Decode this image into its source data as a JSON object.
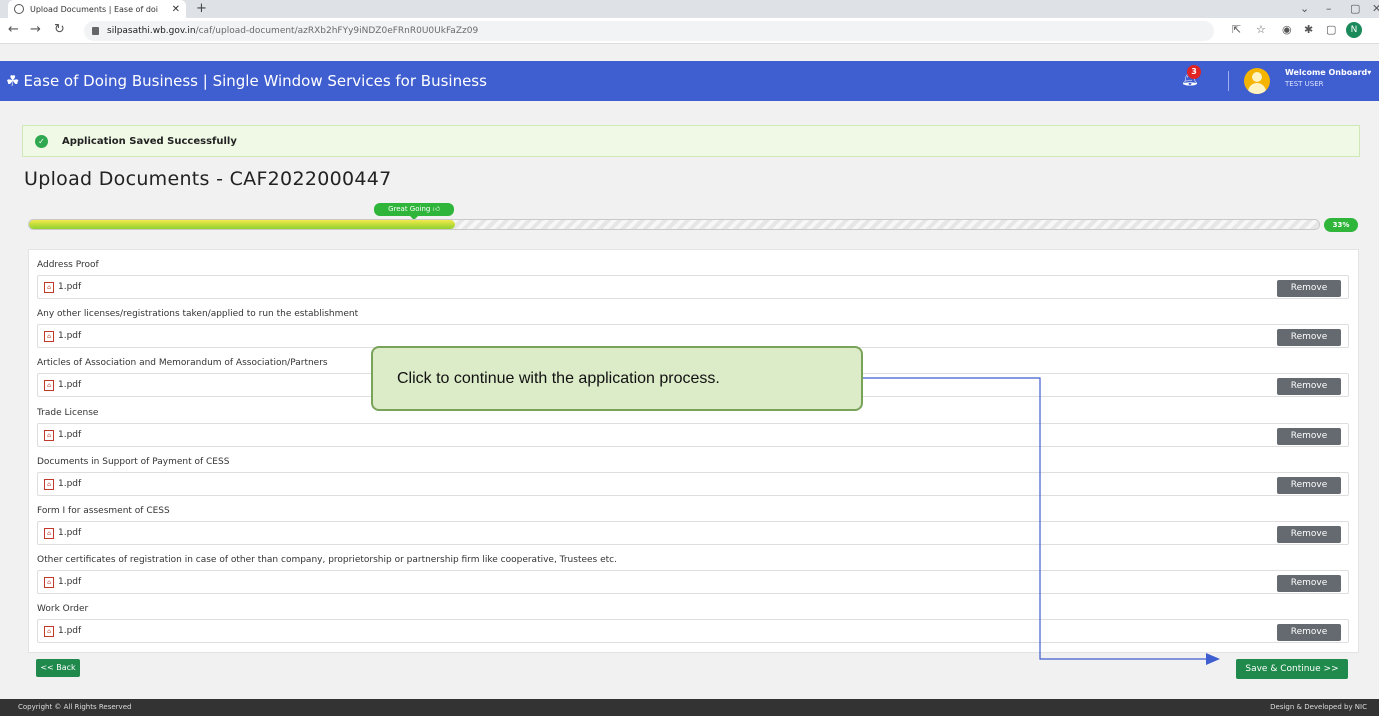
{
  "browser": {
    "tab_title": "Upload Documents | Ease of doi",
    "url_host": "silpasathi.wb.gov.in",
    "url_path": "/caf/upload-document/azRXb2hFYy9iNDZ0eFRnR0U0UkFaZz09",
    "profile_initial": "N"
  },
  "header": {
    "brand": "Ease of Doing Business | Single Window Services for Business",
    "notification_count": "3",
    "welcome": "Welcome Onboard",
    "user": "TEST USER"
  },
  "alert": {
    "message": "Application Saved Successfully"
  },
  "page": {
    "title": "Upload Documents - CAF2022000447"
  },
  "progress": {
    "value": 0.33,
    "label": "33%",
    "tooltip": "Great Going"
  },
  "documents": [
    {
      "label": "Address Proof",
      "file": "1.pdf",
      "action": "Remove"
    },
    {
      "label": "Any other licenses/registrations taken/applied to run the establishment",
      "file": "1.pdf",
      "action": "Remove"
    },
    {
      "label": "Articles of Association and Memorandum of Association/Partners",
      "file": "1.pdf",
      "action": "Remove"
    },
    {
      "label": "Trade License",
      "file": "1.pdf",
      "action": "Remove"
    },
    {
      "label": "Documents in Support of Payment of CESS",
      "file": "1.pdf",
      "action": "Remove"
    },
    {
      "label": "Form I for assesment of CESS",
      "file": "1.pdf",
      "action": "Remove"
    },
    {
      "label": "Other certificates of registration in case of other than company, proprietorship or partnership firm like cooperative, Trustees etc.",
      "file": "1.pdf",
      "action": "Remove"
    },
    {
      "label": "Work Order",
      "file": "1.pdf",
      "action": "Remove"
    }
  ],
  "buttons": {
    "back": "<< Back",
    "save": "Save & Continue >>"
  },
  "callout": {
    "text": "Click to continue with the application process."
  },
  "footer": {
    "copyright": "Copyright © All Rights Reserved",
    "credit": "Design & Developed by NIC"
  },
  "colors": {
    "header": "#3f5ecf",
    "accent_green": "#1f8a4c",
    "progress_badge": "#2fb53a"
  }
}
